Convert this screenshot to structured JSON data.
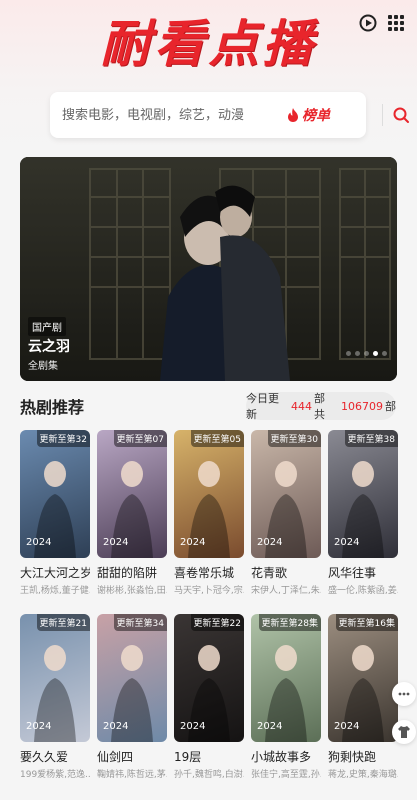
{
  "header": {
    "logo_text": "耐看点播",
    "icons": [
      "play-circle-icon",
      "grid-icon"
    ],
    "brand_color": "#e8252c"
  },
  "search": {
    "placeholder": "搜索电影，电视剧，综艺，动漫",
    "rank_label": "榜单"
  },
  "banner": {
    "tag": "国产剧",
    "title": "云之羽",
    "subtitle": "全剧集"
  },
  "section": {
    "title": "热剧推荐",
    "stat_prefix": "今日更新",
    "today_count": "444",
    "stat_mid": "部 共",
    "total_count": "106709",
    "stat_suffix": "部"
  },
  "dramas": [
    {
      "badge": "更新至第32",
      "year": "2024",
      "title": "大江大河之岁...",
      "cast": "王凯,杨烁,董子健..."
    },
    {
      "badge": "更新至第07",
      "year": "2024",
      "title": "甜甜的陷阱",
      "cast": "谢彬彬,张淼怡,田..."
    },
    {
      "badge": "更新至第05",
      "year": "2024",
      "title": "喜卷常乐城",
      "cast": "马天宇,卜冠今,宗..."
    },
    {
      "badge": "更新至第30",
      "year": "2024",
      "title": "花青歌",
      "cast": "宋伊人,丁泽仁,朱..."
    },
    {
      "badge": "更新至第38",
      "year": "2024",
      "title": "风华往事",
      "cast": "盛一伦,陈紫函,姜..."
    },
    {
      "badge": "更新至第21",
      "year": "2024",
      "title": "要久久爱",
      "cast": "199爱杨紫,范逸..."
    },
    {
      "badge": "更新至第34",
      "year": "2024",
      "title": "仙剑四",
      "cast": "鞠婧祎,陈哲远,茅..."
    },
    {
      "badge": "更新至第22",
      "year": "2024",
      "title": "19层",
      "cast": "孙千,魏哲鸣,白澍..."
    },
    {
      "badge": "更新至第28集",
      "year": "2024",
      "title": "小城故事多",
      "cast": "张佳宁,高至霆,孙..."
    },
    {
      "badge": "更新至第16集",
      "year": "2024",
      "title": "狗剩快跑",
      "cast": "蒋龙,史策,秦海璐..."
    }
  ]
}
